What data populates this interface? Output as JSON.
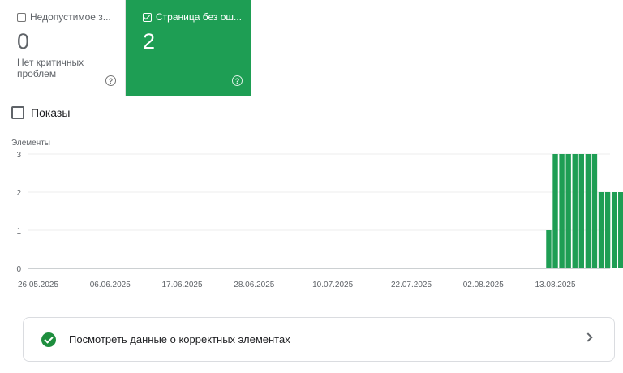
{
  "cards": {
    "invalid": {
      "label": "Недопустимое з...",
      "value": "0",
      "subtitle": "Нет критичных проблем",
      "help_icon": "help-circle-icon"
    },
    "valid": {
      "label": "Страница без ош...",
      "value": "2",
      "help_icon": "help-circle-icon"
    }
  },
  "impressions_toggle": {
    "label": "Показы",
    "checked": false
  },
  "chart_data": {
    "type": "bar",
    "ylabel": "Элементы",
    "ylim": [
      0,
      3
    ],
    "yticks": [
      "0",
      "1",
      "2",
      "3"
    ],
    "color": "#1e9e54",
    "x_tick_labels": [
      "26.05.2025",
      "06.06.2025",
      "17.06.2025",
      "28.06.2025",
      "10.07.2025",
      "22.07.2025",
      "02.08.2025",
      "13.08.2025"
    ],
    "x_range": [
      "2025-05-26",
      "2025-08-23"
    ],
    "bars": [
      {
        "date": "2025-08-12",
        "value": 1
      },
      {
        "date": "2025-08-13",
        "value": 3
      },
      {
        "date": "2025-08-14",
        "value": 3
      },
      {
        "date": "2025-08-15",
        "value": 3
      },
      {
        "date": "2025-08-16",
        "value": 3
      },
      {
        "date": "2025-08-17",
        "value": 3
      },
      {
        "date": "2025-08-18",
        "value": 3
      },
      {
        "date": "2025-08-19",
        "value": 3
      },
      {
        "date": "2025-08-20",
        "value": 2
      },
      {
        "date": "2025-08-21",
        "value": 2
      },
      {
        "date": "2025-08-22",
        "value": 2
      },
      {
        "date": "2025-08-23",
        "value": 2
      }
    ]
  },
  "details_link": {
    "label": "Посмотреть данные о корректных элементах",
    "icon": "check-circle-icon",
    "chevron": "chevron-right-icon"
  }
}
